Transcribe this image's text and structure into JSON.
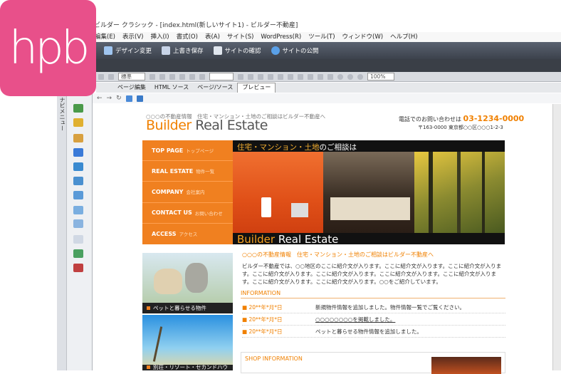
{
  "app": {
    "logo_text": "hpb",
    "title": "ビルダー クラシック - [index.html(新しいサイト1) - ビルダー不動産]"
  },
  "menu": [
    "編集(E)",
    "表示(V)",
    "挿入(I)",
    "書式(O)",
    "表(A)",
    "サイト(S)",
    "WordPress(R)",
    "ツール(T)",
    "ウィンドウ(W)",
    "ヘルプ(H)"
  ],
  "toolbar": {
    "design_change": "デザイン変更",
    "overwrite_save": "上書き保存",
    "site_check": "サイトの確認",
    "site_publish": "サイトの公開"
  },
  "format_bar": {
    "style_value": "標準",
    "zoom_value": "100%"
  },
  "tabs": [
    "ページ編集",
    "HTML ソース",
    "ページ/ソース",
    "プレビュー"
  ],
  "side_panel_label": "ナビメニュー",
  "site": {
    "tagline": "○○○の不動産情報　住宅・マンション・土地のご相談はビルダー不動産へ",
    "brand_a": "Builder",
    "brand_b": " Real Estate",
    "contact_label": "電話でのお問い合わせは",
    "phone": "03-1234-0000",
    "address": "〒163-0000 東京都○○区○○○1-2-3",
    "nav": [
      {
        "label": "TOP PAGE",
        "sub": "トップページ"
      },
      {
        "label": "REAL ESTATE",
        "sub": "物件一覧"
      },
      {
        "label": "COMPANY",
        "sub": "会社案内"
      },
      {
        "label": "CONTACT US",
        "sub": "お問い合わせ"
      },
      {
        "label": "ACCESS",
        "sub": "アクセス"
      }
    ],
    "hero_title_a": "住宅・マンション・土地",
    "hero_title_b": "のご相談は",
    "hero_brand_a": "Builder",
    "hero_brand_b": " Real Estate",
    "pet_caption": "ペットと暮らせる物件",
    "resort_caption": "別荘・リゾート・セカンドハウス",
    "intro_head": "○○○の不動産情報　住宅・マンション・土地のご相談はビルダー不動産へ",
    "intro_body": "ビルダー不動産では、○○地区のここに紹介文が入ります。ここに紹介文が入ります。ここに紹介文が入ります。ここに紹介文が入ります。ここに紹介文が入ります。ここに紹介文が入ります。ここに紹介文が入ります。ここに紹介文が入ります。ここに紹介文が入ります。○○をご紹介しています。",
    "info_head": "INFORMATION",
    "info": [
      {
        "date": "20**年*月*日",
        "text": "新規物件情報を追加しました。物件情報一覧でご覧ください。"
      },
      {
        "date": "20**年*月*日",
        "text": "○○○○○○○○を掲載しました。"
      },
      {
        "date": "20**年*月*日",
        "text": "ペットと暮らせる物件情報を追加しました。"
      }
    ],
    "shop_head": "SHOP INFORMATION"
  }
}
